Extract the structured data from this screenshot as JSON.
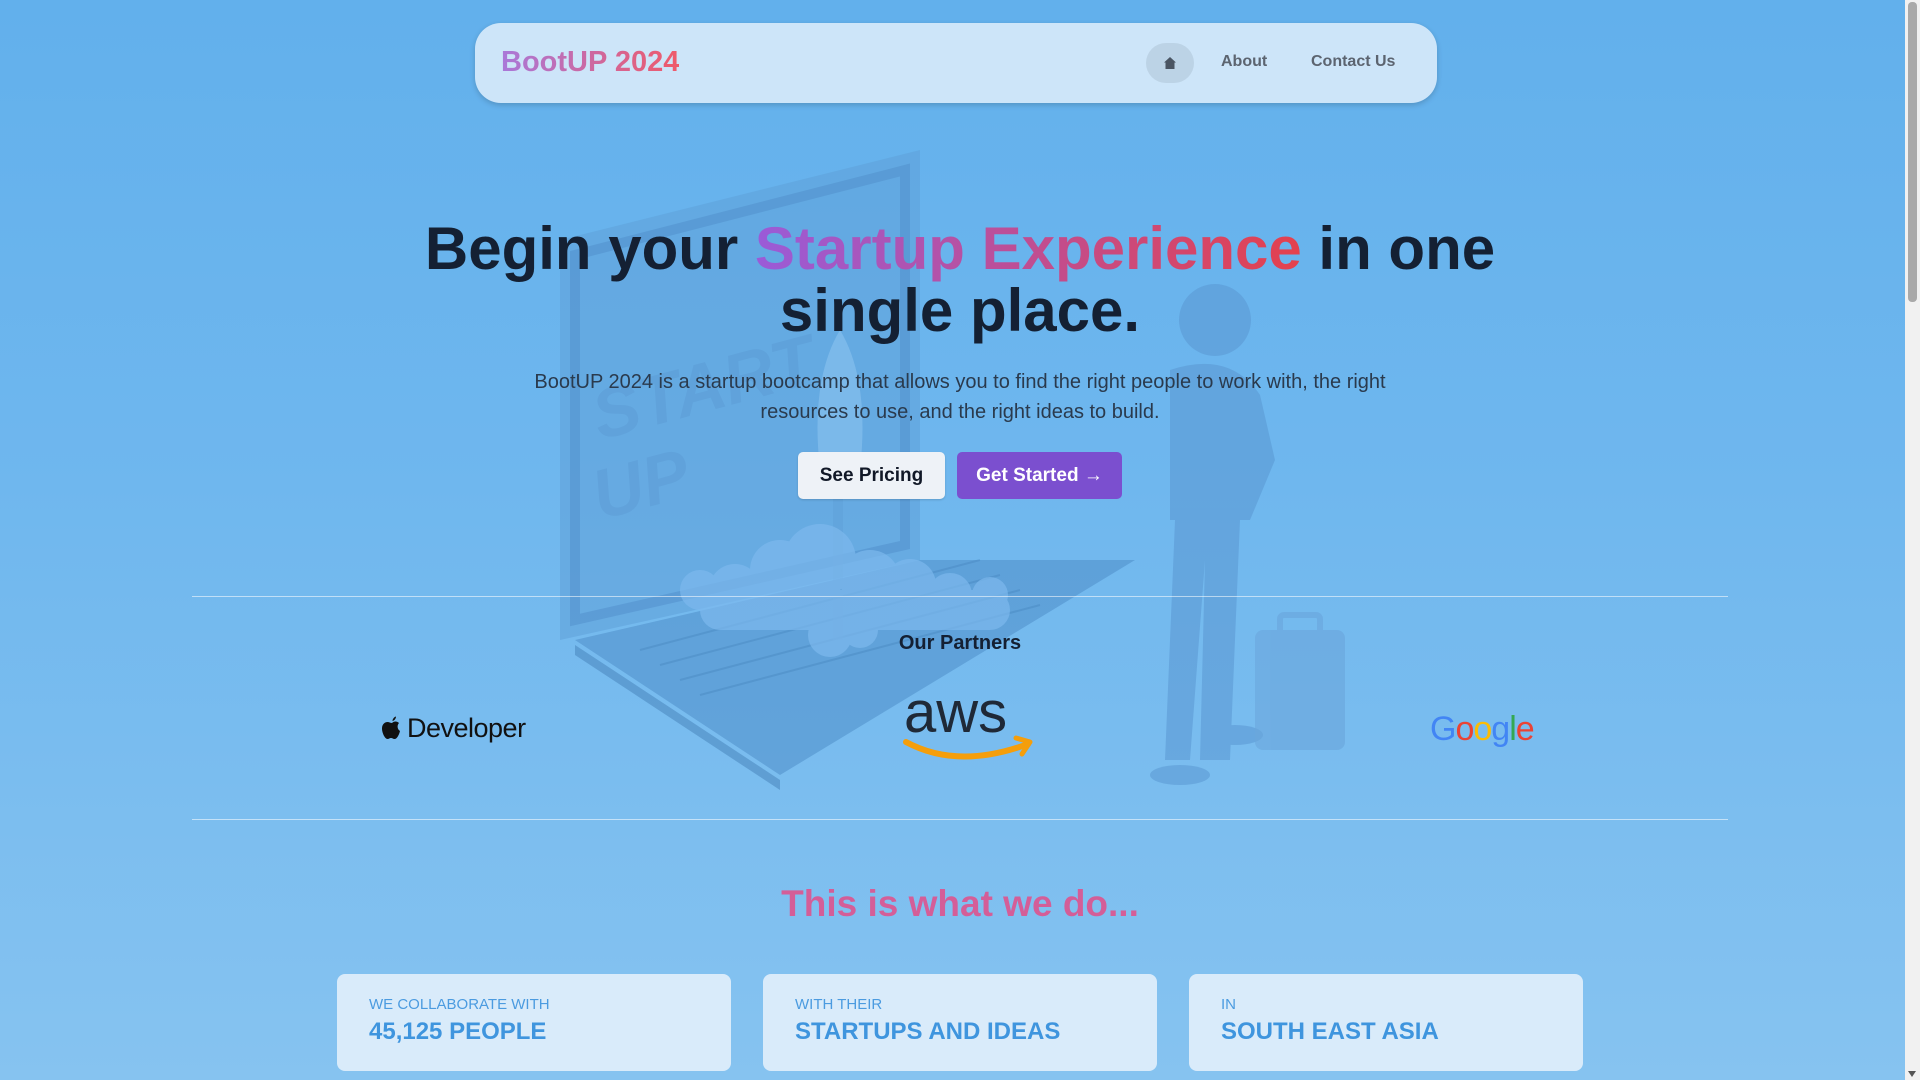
{
  "nav": {
    "brand": "BootUP 2024",
    "home_icon": "home-icon",
    "links": [
      "About",
      "Contact Us"
    ]
  },
  "hero": {
    "title_before": "Begin your ",
    "title_highlight": "Startup Experience",
    "title_after": " in one single place.",
    "subtitle": "BootUP 2024 is a startup bootcamp that allows you to find the right people to work with, the right resources to use, and the right ideas to build.",
    "btn_pricing": "See Pricing",
    "btn_start": "Get Started",
    "btn_start_icon": "→"
  },
  "partners": {
    "title": "Our Partners",
    "logos": {
      "apple": "Developer",
      "aws": "aws",
      "google": [
        "G",
        "o",
        "o",
        "g",
        "l",
        "e"
      ]
    }
  },
  "what_we_do": {
    "title": "This is what we do...",
    "cards": [
      {
        "label": "WE COLLABORATE WITH",
        "value": "45,125 PEOPLE"
      },
      {
        "label": "WITH THEIR",
        "value": "STARTUPS AND IDEAS"
      },
      {
        "label": "IN",
        "value": "SOUTH EAST ASIA"
      }
    ]
  },
  "colors": {
    "accent_purple": "#7b4fcf",
    "gradient_start": "#9a5bd8",
    "gradient_end": "#e4414d",
    "section_title": "#d45e98",
    "google": [
      "#4285F4",
      "#EA4335",
      "#FBBC05",
      "#4285F4",
      "#34A853",
      "#EA4335"
    ]
  }
}
